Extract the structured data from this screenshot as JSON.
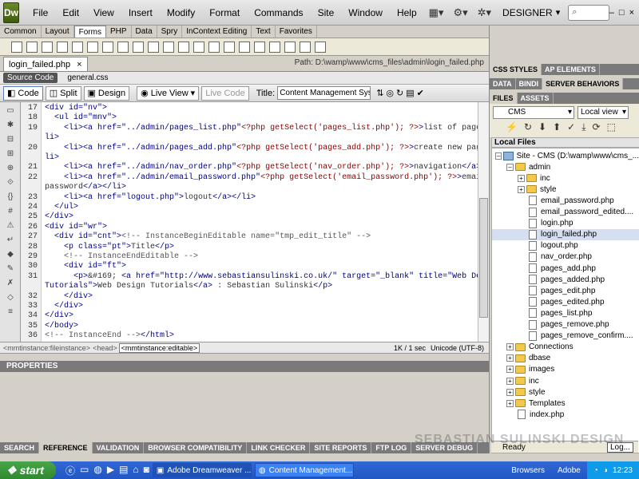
{
  "app": {
    "logo": "Dw",
    "menus": [
      "File",
      "Edit",
      "View",
      "Insert",
      "Modify",
      "Format",
      "Commands",
      "Site",
      "Window",
      "Help"
    ],
    "workspace": "DESIGNER",
    "window_controls": [
      "–",
      "□",
      "×"
    ]
  },
  "insert_tabs": [
    "Common",
    "Layout",
    "Forms",
    "PHP",
    "Data",
    "Spry",
    "InContext Editing",
    "Text",
    "Favorites"
  ],
  "insert_active": "Forms",
  "document": {
    "tab_name": "login_failed.php",
    "close": "×",
    "path": "Path: D:\\wamp\\www\\cms_files\\admin\\login_failed.php",
    "source_code_label": "Source Code",
    "related_file": "general.css"
  },
  "toolbar": {
    "code": "Code",
    "split": "Split",
    "design": "Design",
    "live_view": "Live View",
    "live_code": "Live Code",
    "title_label": "Title:",
    "title_value": "Content Management System"
  },
  "code_lines": [
    {
      "n": "17",
      "html": "<span class='tag'>&lt;div id=\"nv\"&gt;</span>"
    },
    {
      "n": "18",
      "html": "  <span class='tag'>&lt;ul id=\"mnv\"&gt;</span>"
    },
    {
      "n": "19",
      "html": "    <span class='tag'>&lt;li&gt;&lt;a href=\"../admin/pages_list.php\"</span><span class='php'>&lt;?php getSelect('pages_list.php'); ?&gt;</span><span class='tag'>&gt;</span>list of pages<span class='tag'>&lt;/a&gt;&lt;/</span>"
    },
    {
      "n": "",
      "html": "<span class='tag'>li&gt;</span>"
    },
    {
      "n": "20",
      "html": "    <span class='tag'>&lt;li&gt;&lt;a href=\"../admin/pages_add.php\"</span><span class='php'>&lt;?php getSelect('pages_add.php'); ?&gt;</span><span class='tag'>&gt;</span>create new page<span class='tag'>&lt;/a&gt;&lt;/</span>"
    },
    {
      "n": "",
      "html": "<span class='tag'>li&gt;</span>"
    },
    {
      "n": "21",
      "html": "    <span class='tag'>&lt;li&gt;&lt;a href=\"../admin/nav_order.php\"</span><span class='php'>&lt;?php getSelect('nav_order.php'); ?&gt;</span><span class='tag'>&gt;</span>navigation<span class='tag'>&lt;/a&gt;&lt;/li&gt;</span>"
    },
    {
      "n": "22",
      "html": "    <span class='tag'>&lt;li&gt;&lt;a href=\"../admin/email_password.php\"</span><span class='php'>&lt;?php getSelect('email_password.php'); ?&gt;</span><span class='tag'>&gt;</span>email and"
    },
    {
      "n": "",
      "html": "password<span class='tag'>&lt;/a&gt;&lt;/li&gt;</span>"
    },
    {
      "n": "23",
      "html": "    <span class='tag'>&lt;li&gt;&lt;a href=\"logout.php\"&gt;</span>logout<span class='tag'>&lt;/a&gt;&lt;/li&gt;</span>"
    },
    {
      "n": "24",
      "html": "  <span class='tag'>&lt;/ul&gt;</span>"
    },
    {
      "n": "25",
      "html": "<span class='tag'>&lt;/div&gt;</span>"
    },
    {
      "n": "26",
      "html": "<span class='tag'>&lt;div id=\"wr\"&gt;</span>"
    },
    {
      "n": "27",
      "html": "  <span class='tag'>&lt;div id=\"cnt\"&gt;</span><span class='cmt'>&lt;!-- InstanceBeginEditable name=\"tmp_edit_title\" --&gt;</span>"
    },
    {
      "n": "28",
      "html": "    <span class='tag'>&lt;p class=\"pt\"&gt;</span>Title<span class='tag'>&lt;/p&gt;</span>"
    },
    {
      "n": "29",
      "html": "    <span class='cmt'>&lt;!-- InstanceEndEditable --&gt;</span>"
    },
    {
      "n": "30",
      "html": "    <span class='tag'>&lt;div id=\"ft\"&gt;</span>"
    },
    {
      "n": "31",
      "html": "      <span class='tag'>&lt;p&gt;</span>&amp;#169; <span class='tag'>&lt;a href=\"http://www.sebastiansulinski.co.uk/\" target=\"_blank\" title=\"Web Design</span>"
    },
    {
      "n": "",
      "html": "<span class='tag'>Tutorials\"&gt;</span>Web Design Tutorials<span class='tag'>&lt;/a&gt;</span> : Sebastian Sulinski<span class='tag'>&lt;/p&gt;</span>"
    },
    {
      "n": "32",
      "html": "    <span class='tag'>&lt;/div&gt;</span>"
    },
    {
      "n": "33",
      "html": "  <span class='tag'>&lt;/div&gt;</span>"
    },
    {
      "n": "34",
      "html": "<span class='tag'>&lt;/div&gt;</span>"
    },
    {
      "n": "35",
      "html": "<span class='tag'>&lt;/body&gt;</span>"
    },
    {
      "n": "36",
      "html": "<span class='cmt'>&lt;!-- InstanceEnd --&gt;</span><span class='tag'>&lt;/html&gt;</span>"
    }
  ],
  "status": {
    "tag1": "<mmtinstance:fileinstance>",
    "tag2": "<head>",
    "tag3": "<mmtinstance:editable>",
    "size": "1K / 1 sec",
    "encoding": "Unicode (UTF-8)"
  },
  "properties_label": "PROPERTIES",
  "results_tabs": [
    "SEARCH",
    "REFERENCE",
    "VALIDATION",
    "BROWSER COMPATIBILITY",
    "LINK CHECKER",
    "SITE REPORTS",
    "FTP LOG",
    "SERVER DEBUG"
  ],
  "panels": {
    "tabs1": [
      "CSS STYLES",
      "AP ELEMENTS"
    ],
    "tabs2": [
      "DATA",
      "BINDI",
      "SERVER BEHAVIORS"
    ],
    "tabs3": [
      "FILES",
      "ASSETS"
    ],
    "site_select": "CMS",
    "view_select": "Local view",
    "local_files": "Local Files"
  },
  "tree": [
    {
      "label": "Site - CMS (D:\\wamp\\www\\cms_...",
      "type": "site",
      "indent": 0,
      "exp": "–"
    },
    {
      "label": "admin",
      "type": "folder",
      "indent": 1,
      "exp": "–"
    },
    {
      "label": "inc",
      "type": "folder",
      "indent": 2,
      "exp": "+"
    },
    {
      "label": "style",
      "type": "folder",
      "indent": 2,
      "exp": "+"
    },
    {
      "label": "email_password.php",
      "type": "file",
      "indent": 3
    },
    {
      "label": "email_password_edited....",
      "type": "file",
      "indent": 3
    },
    {
      "label": "login.php",
      "type": "file",
      "indent": 3
    },
    {
      "label": "login_failed.php",
      "type": "file",
      "indent": 3,
      "selected": true
    },
    {
      "label": "logout.php",
      "type": "file",
      "indent": 3
    },
    {
      "label": "nav_order.php",
      "type": "file",
      "indent": 3
    },
    {
      "label": "pages_add.php",
      "type": "file",
      "indent": 3
    },
    {
      "label": "pages_added.php",
      "type": "file",
      "indent": 3
    },
    {
      "label": "pages_edit.php",
      "type": "file",
      "indent": 3
    },
    {
      "label": "pages_edited.php",
      "type": "file",
      "indent": 3
    },
    {
      "label": "pages_list.php",
      "type": "file",
      "indent": 3
    },
    {
      "label": "pages_remove.php",
      "type": "file",
      "indent": 3
    },
    {
      "label": "pages_remove_confirm....",
      "type": "file",
      "indent": 3
    },
    {
      "label": "Connections",
      "type": "folder",
      "indent": 1,
      "exp": "+"
    },
    {
      "label": "dbase",
      "type": "folder",
      "indent": 1,
      "exp": "+"
    },
    {
      "label": "images",
      "type": "folder",
      "indent": 1,
      "exp": "+"
    },
    {
      "label": "inc",
      "type": "folder",
      "indent": 1,
      "exp": "+"
    },
    {
      "label": "style",
      "type": "folder",
      "indent": 1,
      "exp": "+"
    },
    {
      "label": "Templates",
      "type": "folder",
      "indent": 1,
      "exp": "+"
    },
    {
      "label": "index.php",
      "type": "file",
      "indent": 2
    }
  ],
  "ready": "Ready",
  "log_button": "Log...",
  "watermark": "SEBASTIAN SULINSKI DESIGN",
  "taskbar": {
    "start": "start",
    "tasks": [
      "Adobe Dreamweaver ...",
      "Content Management..."
    ],
    "browsers": "Browsers",
    "adobe": "Adobe",
    "clock": "12:23"
  }
}
